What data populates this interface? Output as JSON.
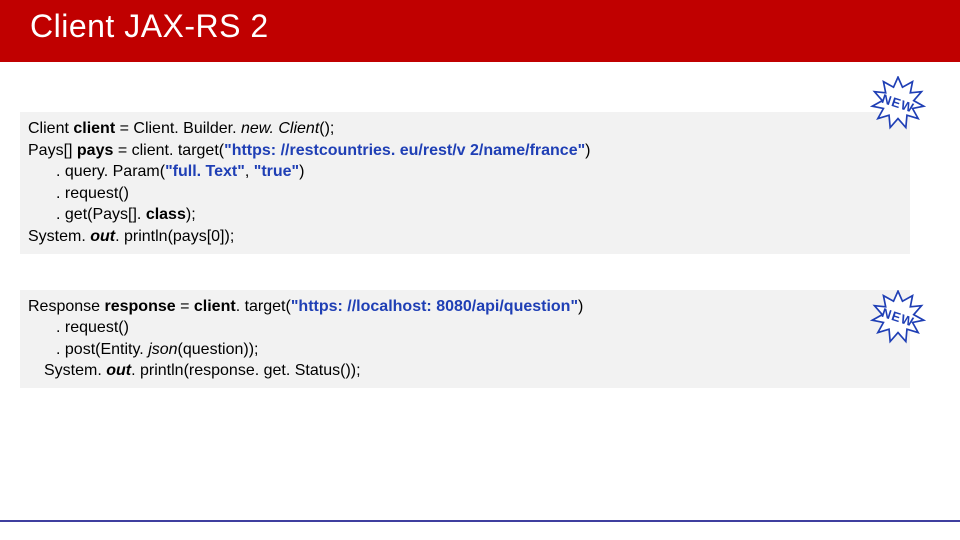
{
  "header": {
    "title": "Client JAX-RS 2"
  },
  "badges": {
    "b1": "NEW",
    "b2": "NEW"
  },
  "code1": {
    "l1a": "Client ",
    "l1b": "client ",
    "l1c": "= Client. Builder. ",
    "l1d": "new. Client",
    "l1e": "();",
    "l2a": "Pays[] ",
    "l2b": "pays ",
    "l2c": "=      client. target(",
    "l2d": "\"https: //restcountries. eu/rest/v 2/name/france\"",
    "l2e": ")",
    "l3a": ". query. Param(",
    "l3b": "\"full. Text\"",
    "l3c": ", ",
    "l3d": "\"true\"",
    "l3e": ")",
    "l4": ". request()",
    "l5a": ". get(Pays[]. ",
    "l5b": "class",
    "l5c": ");",
    "l6a": "System. ",
    "l6b": "out",
    "l6c": ". println(pays[0]);"
  },
  "code2": {
    "l1a": "Response ",
    "l1b": "response ",
    "l1c": "= ",
    "l1d": "client",
    "l1e": ". target(",
    "l1f": "\"https: //localhost: 8080/api/question\"",
    "l1g": ")",
    "l2": ". request()",
    "l3a": ". post(Entity. ",
    "l3b": "json",
    "l3c": "(question));",
    "l4a": "System. ",
    "l4b": "out",
    "l4c": ". println(response. get. Status());"
  }
}
